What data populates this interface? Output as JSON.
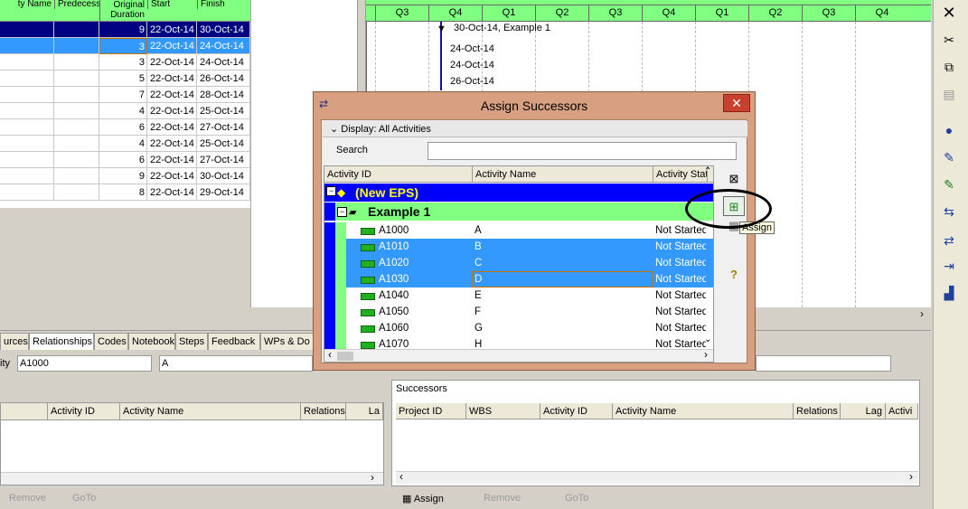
{
  "grid": {
    "headers": [
      "ty Name",
      "Predecess",
      "Original Duration",
      "Start",
      "Finish"
    ],
    "rows": [
      {
        "duration": "9",
        "start": "22-Oct-14",
        "finish": "30-Oct-14",
        "style": "eps"
      },
      {
        "duration": "3",
        "start": "22-Oct-14",
        "finish": "24-Oct-14",
        "style": "sel"
      },
      {
        "duration": "3",
        "start": "22-Oct-14",
        "finish": "24-Oct-14",
        "style": ""
      },
      {
        "duration": "5",
        "start": "22-Oct-14",
        "finish": "26-Oct-14",
        "style": ""
      },
      {
        "duration": "7",
        "start": "22-Oct-14",
        "finish": "28-Oct-14",
        "style": ""
      },
      {
        "duration": "4",
        "start": "22-Oct-14",
        "finish": "25-Oct-14",
        "style": ""
      },
      {
        "duration": "6",
        "start": "22-Oct-14",
        "finish": "27-Oct-14",
        "style": ""
      },
      {
        "duration": "4",
        "start": "22-Oct-14",
        "finish": "25-Oct-14",
        "style": ""
      },
      {
        "duration": "6",
        "start": "22-Oct-14",
        "finish": "27-Oct-14",
        "style": ""
      },
      {
        "duration": "9",
        "start": "22-Oct-14",
        "finish": "30-Oct-14",
        "style": ""
      },
      {
        "duration": "8",
        "start": "22-Oct-14",
        "finish": "29-Oct-14",
        "style": ""
      }
    ]
  },
  "timescale": {
    "quarters": [
      "Q3",
      "Q4",
      "Q1",
      "Q2",
      "Q3",
      "Q4",
      "Q1",
      "Q2",
      "Q3",
      "Q4"
    ],
    "bar_labels": [
      "30-Oct-14, Example 1",
      "24-Oct-14",
      "24-Oct-14",
      "26-Oct-14"
    ]
  },
  "dialog": {
    "title": "Assign Successors",
    "close": "✕",
    "display_filter": "Display: All Activities",
    "search_label": "Search",
    "search_value": "",
    "columns": [
      "Activity ID",
      "Activity Name",
      "Activity Stat"
    ],
    "eps_label": "(New EPS)",
    "project_label": "Example 1",
    "activities": [
      {
        "id": "A1000",
        "name": "A",
        "status": "Not Started",
        "selected": false
      },
      {
        "id": "A1010",
        "name": "B",
        "status": "Not Started",
        "selected": true
      },
      {
        "id": "A1020",
        "name": "C",
        "status": "Not Started",
        "selected": true
      },
      {
        "id": "A1030",
        "name": "D",
        "status": "Not Started",
        "selected": true
      },
      {
        "id": "A1040",
        "name": "E",
        "status": "Not Started",
        "selected": false
      },
      {
        "id": "A1050",
        "name": "F",
        "status": "Not Started",
        "selected": false
      },
      {
        "id": "A1060",
        "name": "G",
        "status": "Not Started",
        "selected": false
      },
      {
        "id": "A1070",
        "name": "H",
        "status": "Not Started",
        "selected": false
      }
    ],
    "assign_tooltip": "Assign"
  },
  "details": {
    "tabs": [
      "urces",
      "Relationships",
      "Codes",
      "Notebook",
      "Steps",
      "Feedback",
      "WPs & Do"
    ],
    "activity_label": "ity",
    "activity_id": "A1000",
    "activity_name": "A",
    "predecessor_cols": [
      "Activity ID",
      "Activity Name",
      "Relations",
      "La"
    ],
    "successors_title": "Successors",
    "successor_cols": [
      "Project ID",
      "WBS",
      "Activity ID",
      "Activity Name",
      "Relations",
      "Lag",
      "Activi"
    ],
    "buttons_left": [
      "Remove",
      "GoTo"
    ],
    "buttons_right": [
      "Assign",
      "Remove",
      "GoTo"
    ]
  },
  "colors": {
    "eps_bg": "#0000ff",
    "eps_text": "#ffff00",
    "project_bg": "#80ff80",
    "selection": "#3399ff",
    "header_green": "#80ff80"
  }
}
